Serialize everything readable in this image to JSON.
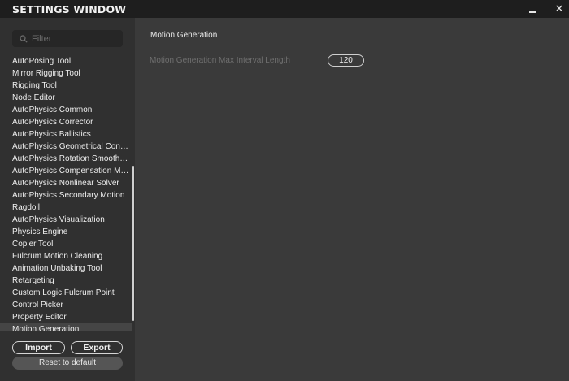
{
  "window": {
    "title": "SETTINGS WINDOW",
    "minimize_label": "",
    "close_label": "✕"
  },
  "sidebar": {
    "search_placeholder": "Filter",
    "items": [
      "AutoPosing Tool",
      "Mirror Rigging Tool",
      "Rigging Tool",
      "Node Editor",
      "AutoPhysics Common",
      "AutoPhysics Corrector",
      "AutoPhysics Ballistics",
      "AutoPhysics Geometrical Constr...",
      "AutoPhysics Rotation Smoothness",
      "AutoPhysics Compensation Moti...",
      "AutoPhysics Nonlinear Solver",
      "AutoPhysics Secondary Motion",
      "Ragdoll",
      "AutoPhysics Visualization",
      "Physics Engine",
      "Copier Tool",
      "Fulcrum Motion Cleaning",
      "Animation Unbaking Tool",
      "Retargeting",
      "Custom Logic Fulcrum Point",
      "Control Picker",
      "Property Editor",
      "Motion Generation"
    ],
    "active_item": "Motion Generation"
  },
  "footer": {
    "import_label": "Import",
    "export_label": "Export",
    "reset_label": "Reset to default"
  },
  "main": {
    "title": "Motion Generation",
    "setting_label": "Motion Generation Max Interval Length",
    "setting_value": "120"
  },
  "colors": {
    "titlebar": "#1e1e1e",
    "sidebar": "#303030",
    "main": "#3a3a3a"
  }
}
